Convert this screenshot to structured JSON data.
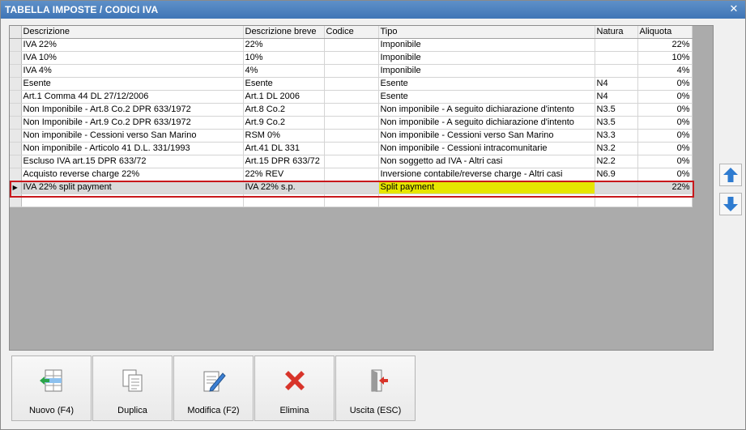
{
  "window": {
    "title": "TABELLA IMPOSTE / CODICI IVA",
    "close_glyph": "✕"
  },
  "grid": {
    "columns": [
      "Descrizione",
      "Descrizione breve",
      "Codice",
      "Tipo",
      "Natura",
      "Aliquota"
    ],
    "rows": [
      {
        "descrizione": "IVA 22%",
        "breve": "22%",
        "codice": "",
        "tipo": "Imponibile",
        "natura": "",
        "aliquota": "22%"
      },
      {
        "descrizione": "IVA 10%",
        "breve": "10%",
        "codice": "",
        "tipo": "Imponibile",
        "natura": "",
        "aliquota": "10%"
      },
      {
        "descrizione": "IVA 4%",
        "breve": "4%",
        "codice": "",
        "tipo": "Imponibile",
        "natura": "",
        "aliquota": "4%"
      },
      {
        "descrizione": "Esente",
        "breve": "Esente",
        "codice": "",
        "tipo": "Esente",
        "natura": "N4",
        "aliquota": "0%"
      },
      {
        "descrizione": "Art.1 Comma 44 DL 27/12/2006",
        "breve": "Art.1 DL 2006",
        "codice": "",
        "tipo": "Esente",
        "natura": "N4",
        "aliquota": "0%"
      },
      {
        "descrizione": "Non Imponibile - Art.8 Co.2 DPR 633/1972",
        "breve": "Art.8 Co.2",
        "codice": "",
        "tipo": "Non imponibile - A seguito dichiarazione d'intento",
        "natura": "N3.5",
        "aliquota": "0%"
      },
      {
        "descrizione": "Non Imponibile - Art.9 Co.2 DPR 633/1972",
        "breve": "Art.9 Co.2",
        "codice": "",
        "tipo": "Non imponibile - A seguito dichiarazione d'intento",
        "natura": "N3.5",
        "aliquota": "0%"
      },
      {
        "descrizione": "Non imponibile - Cessioni verso San Marino",
        "breve": "RSM 0%",
        "codice": "",
        "tipo": "Non imponibile - Cessioni verso San Marino",
        "natura": "N3.3",
        "aliquota": "0%"
      },
      {
        "descrizione": "Non imponibile - Articolo 41 D.L. 331/1993",
        "breve": "Art.41 DL 331",
        "codice": "",
        "tipo": "Non imponibile - Cessioni intracomunitarie",
        "natura": "N3.2",
        "aliquota": "0%"
      },
      {
        "descrizione": "Escluso IVA art.15 DPR 633/72",
        "breve": "Art.15 DPR 633/72",
        "codice": "",
        "tipo": "Non soggetto ad IVA - Altri casi",
        "natura": "N2.2",
        "aliquota": "0%"
      },
      {
        "descrizione": "Acquisto reverse charge 22%",
        "breve": "22% REV",
        "codice": "",
        "tipo": "Inversione contabile/reverse charge - Altri casi",
        "natura": "N6.9",
        "aliquota": "0%"
      },
      {
        "descrizione": "IVA 22% split payment",
        "breve": "IVA 22% s.p.",
        "codice": "",
        "tipo": "Split payment",
        "natura": "",
        "aliquota": "22%"
      },
      {
        "descrizione": "",
        "breve": "",
        "codice": "",
        "tipo": "",
        "natura": "",
        "aliquota": ""
      }
    ],
    "current_row_indicator": "▶",
    "highlight_color": "#c8181c",
    "tipo_highlight_color": "#e6e600"
  },
  "side_buttons": {
    "up_icon": "arrow-up-icon",
    "down_icon": "arrow-down-icon",
    "color": "#2e7bd0"
  },
  "toolbar": {
    "nuovo": "Nuovo (F4)",
    "duplica": "Duplica",
    "modifica": "Modifica (F2)",
    "elimina": "Elimina",
    "uscita": "Uscita (ESC)"
  }
}
